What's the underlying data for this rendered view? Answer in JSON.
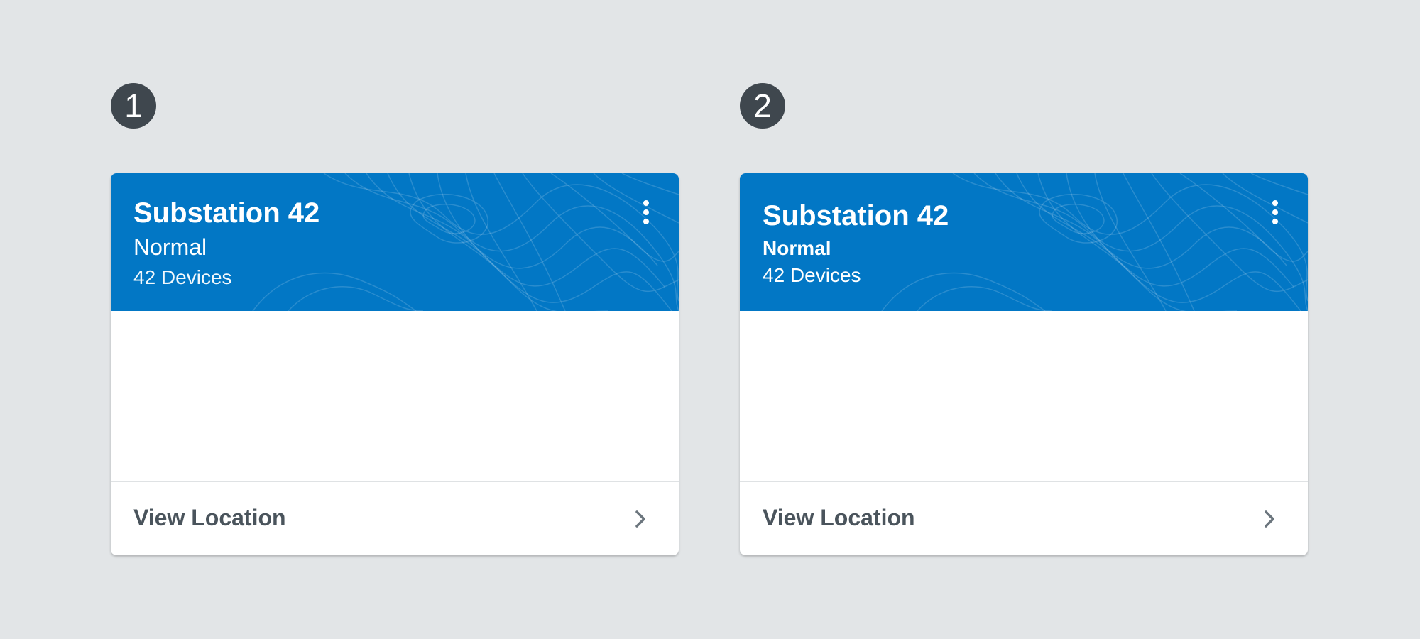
{
  "variants": [
    {
      "step": "1",
      "card": {
        "title": "Substation 42",
        "status": "Normal",
        "device_count": "42 Devices",
        "footer_link": "View Location"
      }
    },
    {
      "step": "2",
      "card": {
        "title": "Substation 42",
        "status": "Normal",
        "device_count": "42 Devices",
        "footer_link": "View Location"
      }
    }
  ],
  "colors": {
    "background": "#e2e5e7",
    "card_header": "#0277c5",
    "badge": "#3f474e",
    "footer_text": "#4a545c"
  },
  "icons": {
    "menu": "more-vertical-icon",
    "link": "chevron-right-icon"
  }
}
